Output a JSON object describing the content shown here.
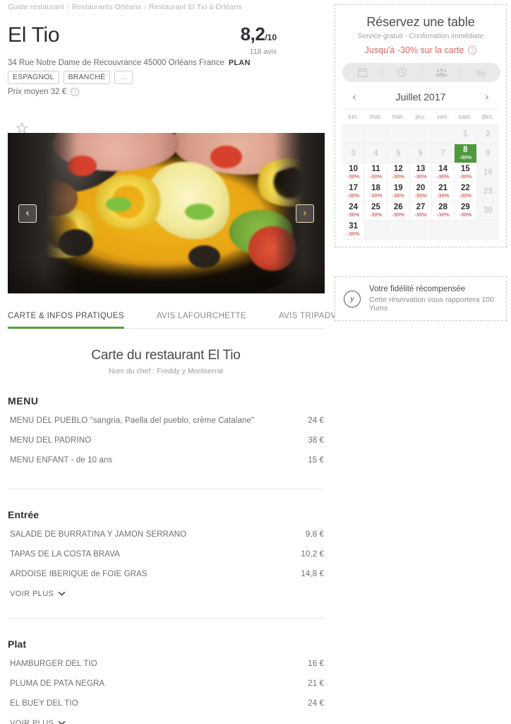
{
  "breadcrumb": {
    "items": [
      "Guide restaurant",
      "Restaurants Orléans",
      "Restaurant El Tio à Orléans"
    ],
    "separator": "/"
  },
  "restaurant": {
    "name": "El Tio",
    "rating_score": "8,2",
    "rating_scale": "/10",
    "review_count": "118 avis",
    "address": "34 Rue Notre Dame de Recouvrance 45000 Orléans France",
    "plan_label": "PLAN",
    "tags": [
      "ESPAGNOL",
      "BRANCHÉ"
    ],
    "tags_more": "...",
    "average_price": "Prix moyen 32 €",
    "info_icon": "info-icon"
  },
  "photo": {
    "favorite_icon": "star-outline-icon",
    "prev_label": "‹",
    "next_label": "›",
    "alt": "Paella de fruits de mer"
  },
  "tabs": [
    {
      "label": "CARTE & INFOS PRATIQUES",
      "active": true
    },
    {
      "label": "AVIS LAFOURCHETTE",
      "active": false
    },
    {
      "label": "AVIS TRIPADVISOR",
      "active": false
    }
  ],
  "menu": {
    "title": "Carte du restaurant El Tio",
    "chef": "Nom du chef : Freddy y Montserrat",
    "voir_plus_label": "VOIR PLUS",
    "sections": [
      {
        "title": "MENU",
        "caps": true,
        "show_more": false,
        "items": [
          {
            "name": "MENU DEL PUEBLO \"sangria, Paella del pueblo, crème Catalane\"",
            "price": "24 €"
          },
          {
            "name": "MENU DEL PADRINO",
            "price": "38 €"
          },
          {
            "name": "MENU ENFANT - de 10 ans",
            "price": "15 €"
          }
        ]
      },
      {
        "title": "Entrée",
        "caps": false,
        "show_more": true,
        "items": [
          {
            "name": "SALADE DE BURRATINA Y JAMON SERRANO",
            "price": "9,8 €"
          },
          {
            "name": "TAPAS DE LA COSTA BRAVA",
            "price": "10,2 €"
          },
          {
            "name": "ARDOISE IBERIQUE de FOIE GRAS",
            "price": "14,8 €"
          }
        ]
      },
      {
        "title": "Plat",
        "caps": false,
        "show_more": true,
        "items": [
          {
            "name": "HAMBURGER DEL TIO",
            "price": "16 €"
          },
          {
            "name": "PLUMA DE PATA NEGRA",
            "price": "21 €"
          },
          {
            "name": "EL BUEY DEL TIO",
            "price": "24 €"
          }
        ]
      }
    ]
  },
  "booking": {
    "title": "Réservez une table",
    "subtitle": "Service gratuit - Confirmation immédiate",
    "promo": "Jusqu'à -30% sur la carte",
    "promo_info_icon": "info-icon",
    "steps": [
      {
        "icon": "calendar-icon",
        "label": ""
      },
      {
        "icon": "clock-icon",
        "label": ""
      },
      {
        "icon": "people-icon",
        "label": ""
      },
      {
        "icon": "percent-icon",
        "label": "%"
      }
    ],
    "calendar": {
      "prev_label": "‹",
      "next_label": "›",
      "month": "Juillet 2017",
      "weekdays": [
        "lun.",
        "mar.",
        "mer.",
        "jeu.",
        "ven.",
        "sam.",
        "dim."
      ],
      "promo_label": "-30%",
      "weeks": [
        [
          {
            "day": "",
            "state": "blank"
          },
          {
            "day": "",
            "state": "blank"
          },
          {
            "day": "",
            "state": "blank"
          },
          {
            "day": "",
            "state": "blank"
          },
          {
            "day": "",
            "state": "blank"
          },
          {
            "day": "1",
            "state": "muted"
          },
          {
            "day": "2",
            "state": "muted"
          }
        ],
        [
          {
            "day": "3",
            "state": "muted"
          },
          {
            "day": "4",
            "state": "muted"
          },
          {
            "day": "5",
            "state": "muted"
          },
          {
            "day": "6",
            "state": "muted"
          },
          {
            "day": "7",
            "state": "muted"
          },
          {
            "day": "8",
            "state": "selected",
            "promo": "-30%"
          },
          {
            "day": "9",
            "state": "muted"
          }
        ],
        [
          {
            "day": "10",
            "state": "available",
            "promo": "-30%"
          },
          {
            "day": "11",
            "state": "available",
            "promo": "-30%"
          },
          {
            "day": "12",
            "state": "available",
            "promo": "-30%"
          },
          {
            "day": "13",
            "state": "available",
            "promo": "-30%"
          },
          {
            "day": "14",
            "state": "available",
            "promo": "-30%"
          },
          {
            "day": "15",
            "state": "available",
            "promo": "-30%"
          },
          {
            "day": "16",
            "state": "muted"
          }
        ],
        [
          {
            "day": "17",
            "state": "available",
            "promo": "-30%"
          },
          {
            "day": "18",
            "state": "available",
            "promo": "-30%"
          },
          {
            "day": "19",
            "state": "available",
            "promo": "-30%"
          },
          {
            "day": "20",
            "state": "available",
            "promo": "-30%"
          },
          {
            "day": "21",
            "state": "available",
            "promo": "-30%"
          },
          {
            "day": "22",
            "state": "available",
            "promo": "-30%"
          },
          {
            "day": "23",
            "state": "muted"
          }
        ],
        [
          {
            "day": "24",
            "state": "available",
            "promo": "-30%"
          },
          {
            "day": "25",
            "state": "available",
            "promo": "-30%"
          },
          {
            "day": "26",
            "state": "available",
            "promo": "-30%"
          },
          {
            "day": "27",
            "state": "available",
            "promo": "-30%"
          },
          {
            "day": "28",
            "state": "available",
            "promo": "-30%"
          },
          {
            "day": "29",
            "state": "available",
            "promo": "-30%"
          },
          {
            "day": "30",
            "state": "muted"
          }
        ],
        [
          {
            "day": "31",
            "state": "available",
            "promo": "-30%"
          },
          {
            "day": "",
            "state": "blank"
          },
          {
            "day": "",
            "state": "blank"
          },
          {
            "day": "",
            "state": "blank"
          },
          {
            "day": "",
            "state": "blank"
          },
          {
            "day": "",
            "state": "blank"
          },
          {
            "day": "",
            "state": "blank"
          }
        ]
      ]
    }
  },
  "loyalty": {
    "badge_icon": "yums-icon",
    "badge_letter": "y",
    "title": "Votre fidélité récompensée",
    "subtitle": "Cette réservation vous rapportera 100 Yums"
  },
  "colors": {
    "accent_green": "#4d9a3e",
    "promo_red": "#d96a62",
    "text_dark": "#2f2f2f",
    "text_muted": "#8d8d8d",
    "border": "#e6e6e6"
  }
}
